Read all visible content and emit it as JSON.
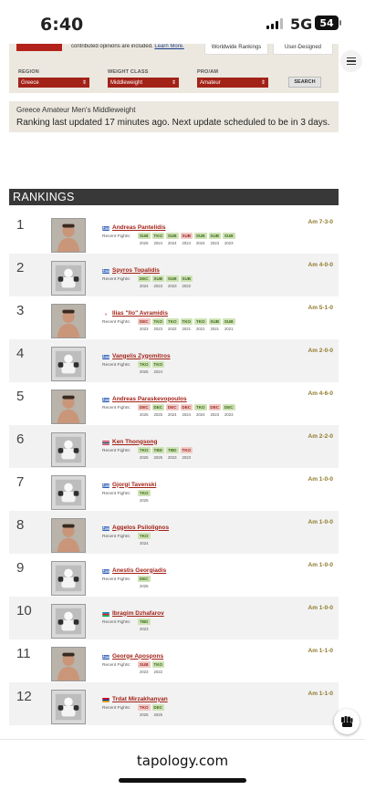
{
  "status_bar": {
    "time": "6:40",
    "network": "5G",
    "battery": "54"
  },
  "search_panel": {
    "promo_text": "contributed opinions are included.",
    "promo_link": "Learn More.",
    "chips": [
      "Worldwide Rankings",
      "User-Designed"
    ],
    "filters": [
      {
        "label": "REGION",
        "value": "Greece"
      },
      {
        "label": "WEIGHT CLASS",
        "value": "Middleweight"
      },
      {
        "label": "PRO/AM",
        "value": "Amateur"
      }
    ],
    "search_label": "SEARCH"
  },
  "notice": {
    "title": "Greece Amateur Men's Middleweight",
    "text": "Ranking last updated 17 minutes ago. Next update scheduled to be in 3 days."
  },
  "rankings_title": "RANKINGS",
  "recent_fights_label": "Recent Fights:",
  "fighters": [
    {
      "rank": "1",
      "name": "Andreas Pantelidis",
      "record": "Am 7-3-0",
      "flag": "greece",
      "photo": "photo-real",
      "fights": [
        [
          "SUB",
          "w",
          "2025"
        ],
        [
          "TKO",
          "w",
          "2024"
        ],
        [
          "SUB",
          "w",
          "2024"
        ],
        [
          "SUB",
          "l",
          "2024"
        ],
        [
          "SUB",
          "w",
          "2024"
        ],
        [
          "SUB",
          "w",
          "2023"
        ],
        [
          "SUB",
          "w",
          "2023"
        ]
      ]
    },
    {
      "rank": "2",
      "name": "Spyros Topalidis",
      "record": "Am 4-0-0",
      "flag": "greece",
      "photo": "placeholder",
      "fights": [
        [
          "DEC",
          "w",
          "2024"
        ],
        [
          "SUB",
          "w",
          "2023"
        ],
        [
          "SUB",
          "w",
          "2023"
        ],
        [
          "SUB",
          "w",
          "2022"
        ]
      ]
    },
    {
      "rank": "3",
      "name": "Ilias \"Ilo\" Avramidis",
      "record": "Am 5-1-0",
      "flag": "unknown",
      "photo": "photo-real",
      "fights": [
        [
          "DEC",
          "l",
          "2023"
        ],
        [
          "TKO",
          "w",
          "2023"
        ],
        [
          "TKO",
          "w",
          "2022"
        ],
        [
          "TKO",
          "w",
          "2021"
        ],
        [
          "TKO",
          "w",
          "2021"
        ],
        [
          "SUB",
          "w",
          "2021"
        ],
        [
          "SUB",
          "w",
          "2021"
        ]
      ]
    },
    {
      "rank": "4",
      "name": "Vangelis Zygomitros",
      "record": "Am 2-0-0",
      "flag": "greece",
      "photo": "placeholder",
      "fights": [
        [
          "TKO",
          "w",
          "2025"
        ],
        [
          "TKO",
          "w",
          "2024"
        ]
      ]
    },
    {
      "rank": "5",
      "name": "Andreas Paraskevopoulos",
      "record": "Am 4-6-0",
      "flag": "greece",
      "photo": "photo-real",
      "fights": [
        [
          "DEC",
          "l",
          "2025"
        ],
        [
          "DEC",
          "w",
          "2025"
        ],
        [
          "DEC",
          "l",
          "2024"
        ],
        [
          "DEC",
          "l",
          "2024"
        ],
        [
          "TKO",
          "w",
          "2024"
        ],
        [
          "DEC",
          "l",
          "2023"
        ],
        [
          "DEC",
          "w",
          "2023"
        ]
      ]
    },
    {
      "rank": "6",
      "name": "Ken Thongsong",
      "record": "Am 2-2-0",
      "flag": "thailand",
      "photo": "placeholder",
      "fights": [
        [
          "TKO",
          "w",
          "2025"
        ],
        [
          "TBD",
          "w",
          "2025"
        ],
        [
          "TBD",
          "w",
          "2023"
        ],
        [
          "TKO",
          "l",
          "2023"
        ]
      ]
    },
    {
      "rank": "7",
      "name": "Gjorgi Tavenski",
      "record": "Am 1-0-0",
      "flag": "greece",
      "photo": "placeholder",
      "fights": [
        [
          "TKO",
          "w",
          "2025"
        ]
      ]
    },
    {
      "rank": "8",
      "name": "Aggelos Psilolignos",
      "record": "Am 1-0-0",
      "flag": "greece",
      "photo": "photo-real",
      "fights": [
        [
          "TKO",
          "w",
          "2024"
        ]
      ]
    },
    {
      "rank": "9",
      "name": "Anestis Georgiadis",
      "record": "Am 1-0-0",
      "flag": "greece",
      "photo": "placeholder",
      "fights": [
        [
          "DEC",
          "w",
          "2025"
        ]
      ]
    },
    {
      "rank": "10",
      "name": "Ibragim Dzhafarov",
      "record": "Am 1-0-0",
      "flag": "azerbaijan",
      "photo": "placeholder",
      "fights": [
        [
          "TBD",
          "w",
          "2023"
        ]
      ]
    },
    {
      "rank": "11",
      "name": "George Apospons",
      "record": "Am 1-1-0",
      "flag": "greece",
      "photo": "photo-real",
      "fights": [
        [
          "SUB",
          "l",
          "2023"
        ],
        [
          "TKO",
          "w",
          "2022"
        ]
      ]
    },
    {
      "rank": "12",
      "name": "Trdat Mirzakhanyan",
      "record": "Am 1-1-0",
      "flag": "armenia",
      "photo": "placeholder",
      "fights": [
        [
          "TKO",
          "l",
          "2025"
        ],
        [
          "DEC",
          "w",
          "2025"
        ]
      ]
    }
  ],
  "colors": {
    "accent": "#a32218",
    "win": "#cfe3b5",
    "loss": "#f1cac6",
    "record": "#8f7a2c"
  },
  "footer": {
    "domain": "tapology.com"
  }
}
